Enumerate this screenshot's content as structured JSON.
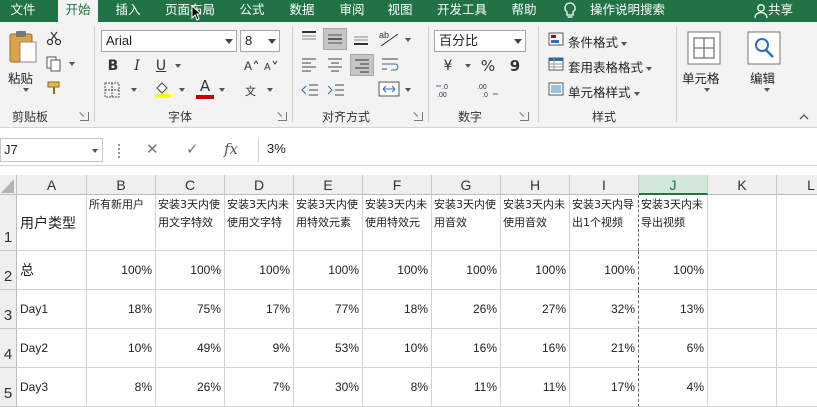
{
  "tabs": [
    {
      "label": "文件",
      "active": false
    },
    {
      "label": "开始",
      "active": true
    },
    {
      "label": "插入",
      "active": false
    },
    {
      "label": "页面布局",
      "active": false
    },
    {
      "label": "公式",
      "active": false
    },
    {
      "label": "数据",
      "active": false
    },
    {
      "label": "审阅",
      "active": false
    },
    {
      "label": "视图",
      "active": false
    },
    {
      "label": "开发工具",
      "active": false
    },
    {
      "label": "帮助",
      "active": false
    }
  ],
  "tell_me": "操作说明搜索",
  "share": "共享",
  "clipboard": {
    "paste": "粘贴",
    "group": "剪贴板"
  },
  "font": {
    "name": "Arial",
    "size": "8",
    "group": "字体",
    "bold": "B",
    "italic": "I",
    "underline": "U",
    "font_color_glyph": "A"
  },
  "alignment": {
    "group": "对齐方式"
  },
  "number": {
    "format": "百分比",
    "group": "数字",
    "currency": "¥",
    "percent": "%",
    "comma": "9"
  },
  "styles": {
    "conditional": "条件格式",
    "table": "套用表格格式",
    "cell": "单元格样式",
    "group": "样式"
  },
  "cells": {
    "label": "单元格"
  },
  "editing": {
    "label": "编辑"
  },
  "accent_color": "#217346",
  "name_box": "J7",
  "formula_value": "3%",
  "columns": [
    "A",
    "B",
    "C",
    "D",
    "E",
    "F",
    "G",
    "H",
    "I",
    "J",
    "K",
    "L"
  ],
  "rows": [
    {
      "num": "1",
      "cells": [
        "用户类型",
        "所有新用户",
        "安装3天内使用文字特效",
        "安装3天内未使用文字特",
        "安装3天内使用特效元素",
        "安装3天内未使用特效元",
        "安装3天内使用音效",
        "安装3天内未使用音效",
        "安装3天内导出1个视频",
        "安装3天内未导出视频"
      ]
    },
    {
      "num": "2",
      "cells": [
        "总",
        "100%",
        "100%",
        "100%",
        "100%",
        "100%",
        "100%",
        "100%",
        "100%",
        "100%"
      ]
    },
    {
      "num": "3",
      "cells": [
        "Day1",
        "18%",
        "75%",
        "17%",
        "77%",
        "18%",
        "26%",
        "27%",
        "32%",
        "13%"
      ]
    },
    {
      "num": "4",
      "cells": [
        "Day2",
        "10%",
        "49%",
        "9%",
        "53%",
        "10%",
        "16%",
        "16%",
        "21%",
        "6%"
      ]
    },
    {
      "num": "5",
      "cells": [
        "Day3",
        "8%",
        "26%",
        "7%",
        "30%",
        "8%",
        "11%",
        "11%",
        "17%",
        "4%"
      ]
    }
  ]
}
